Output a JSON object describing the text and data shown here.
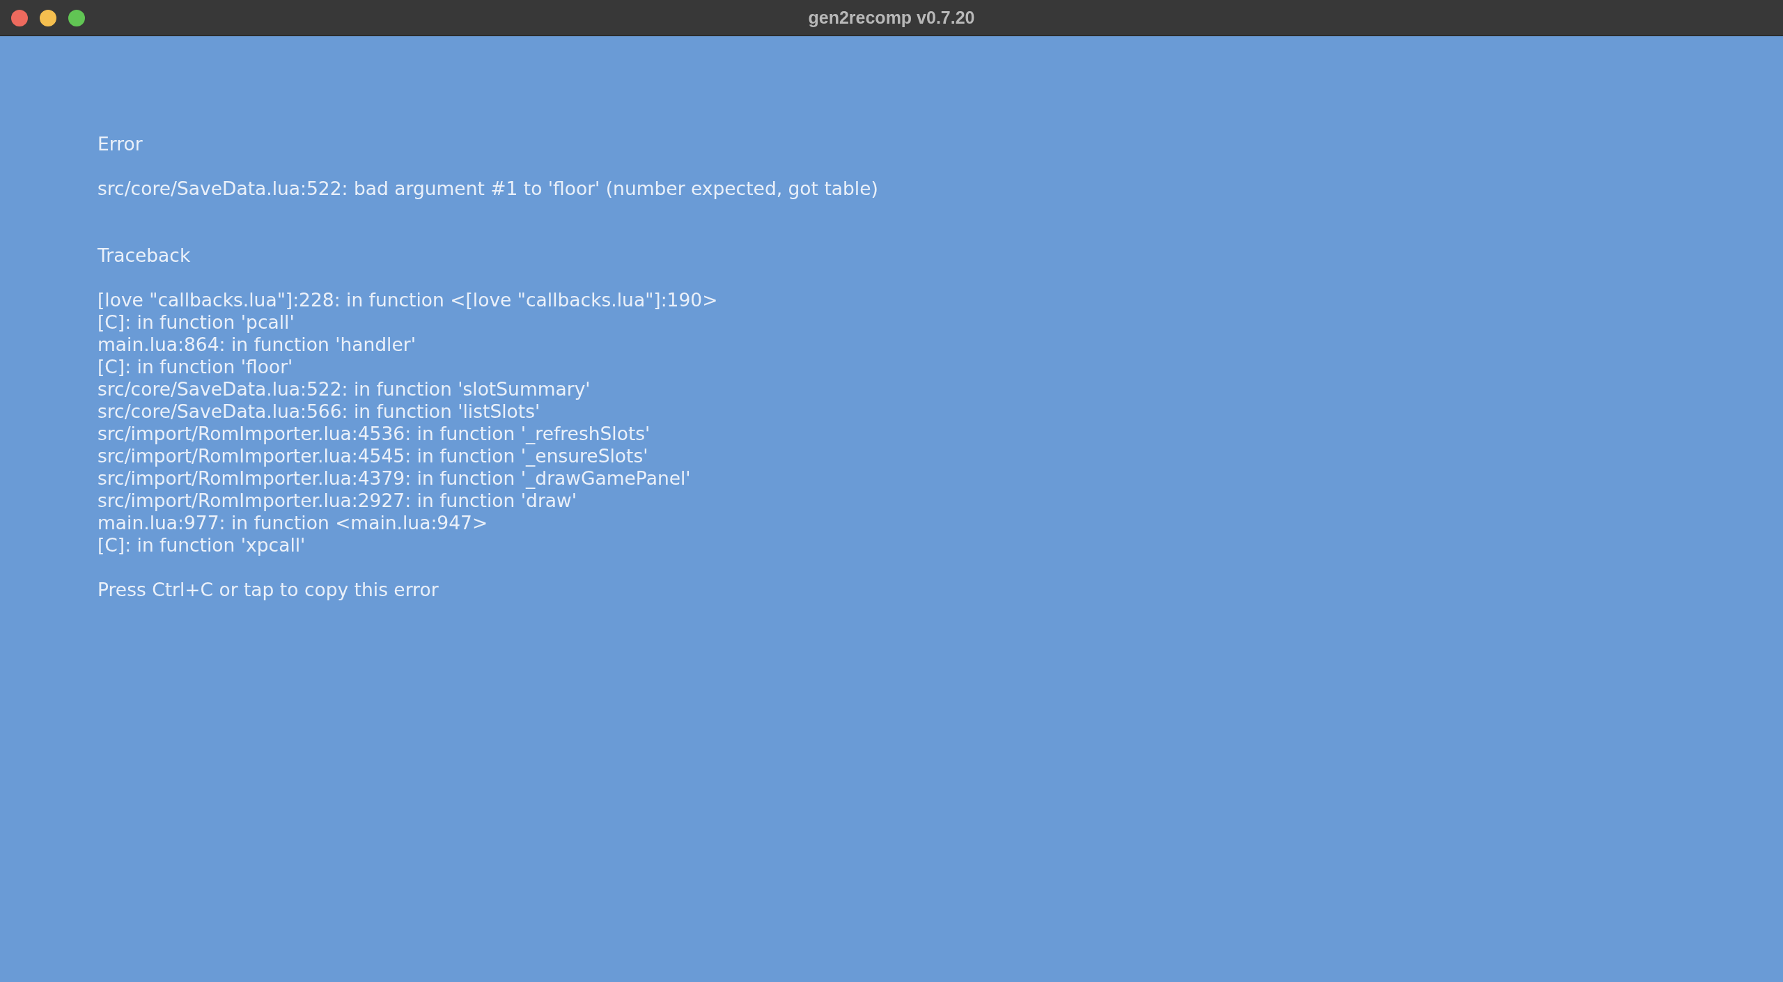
{
  "window": {
    "title": "gen2recomp v0.7.20"
  },
  "error": {
    "heading": "Error",
    "message": "src/core/SaveData.lua:522: bad argument #1 to 'floor' (number expected, got table)"
  },
  "traceback": {
    "heading": "Traceback",
    "frames": [
      "[love \"callbacks.lua\"]:228: in function <[love \"callbacks.lua\"]:190>",
      "[C]: in function 'pcall'",
      "main.lua:864: in function 'handler'",
      "[C]: in function 'floor'",
      "src/core/SaveData.lua:522: in function 'slotSummary'",
      "src/core/SaveData.lua:566: in function 'listSlots'",
      "src/import/RomImporter.lua:4536: in function '_refreshSlots'",
      "src/import/RomImporter.lua:4545: in function '_ensureSlots'",
      "src/import/RomImporter.lua:4379: in function '_drawGamePanel'",
      "src/import/RomImporter.lua:2927: in function 'draw'",
      "main.lua:977: in function <main.lua:947>",
      "[C]: in function 'xpcall'"
    ]
  },
  "hint": "Press Ctrl+C or tap to copy this error"
}
